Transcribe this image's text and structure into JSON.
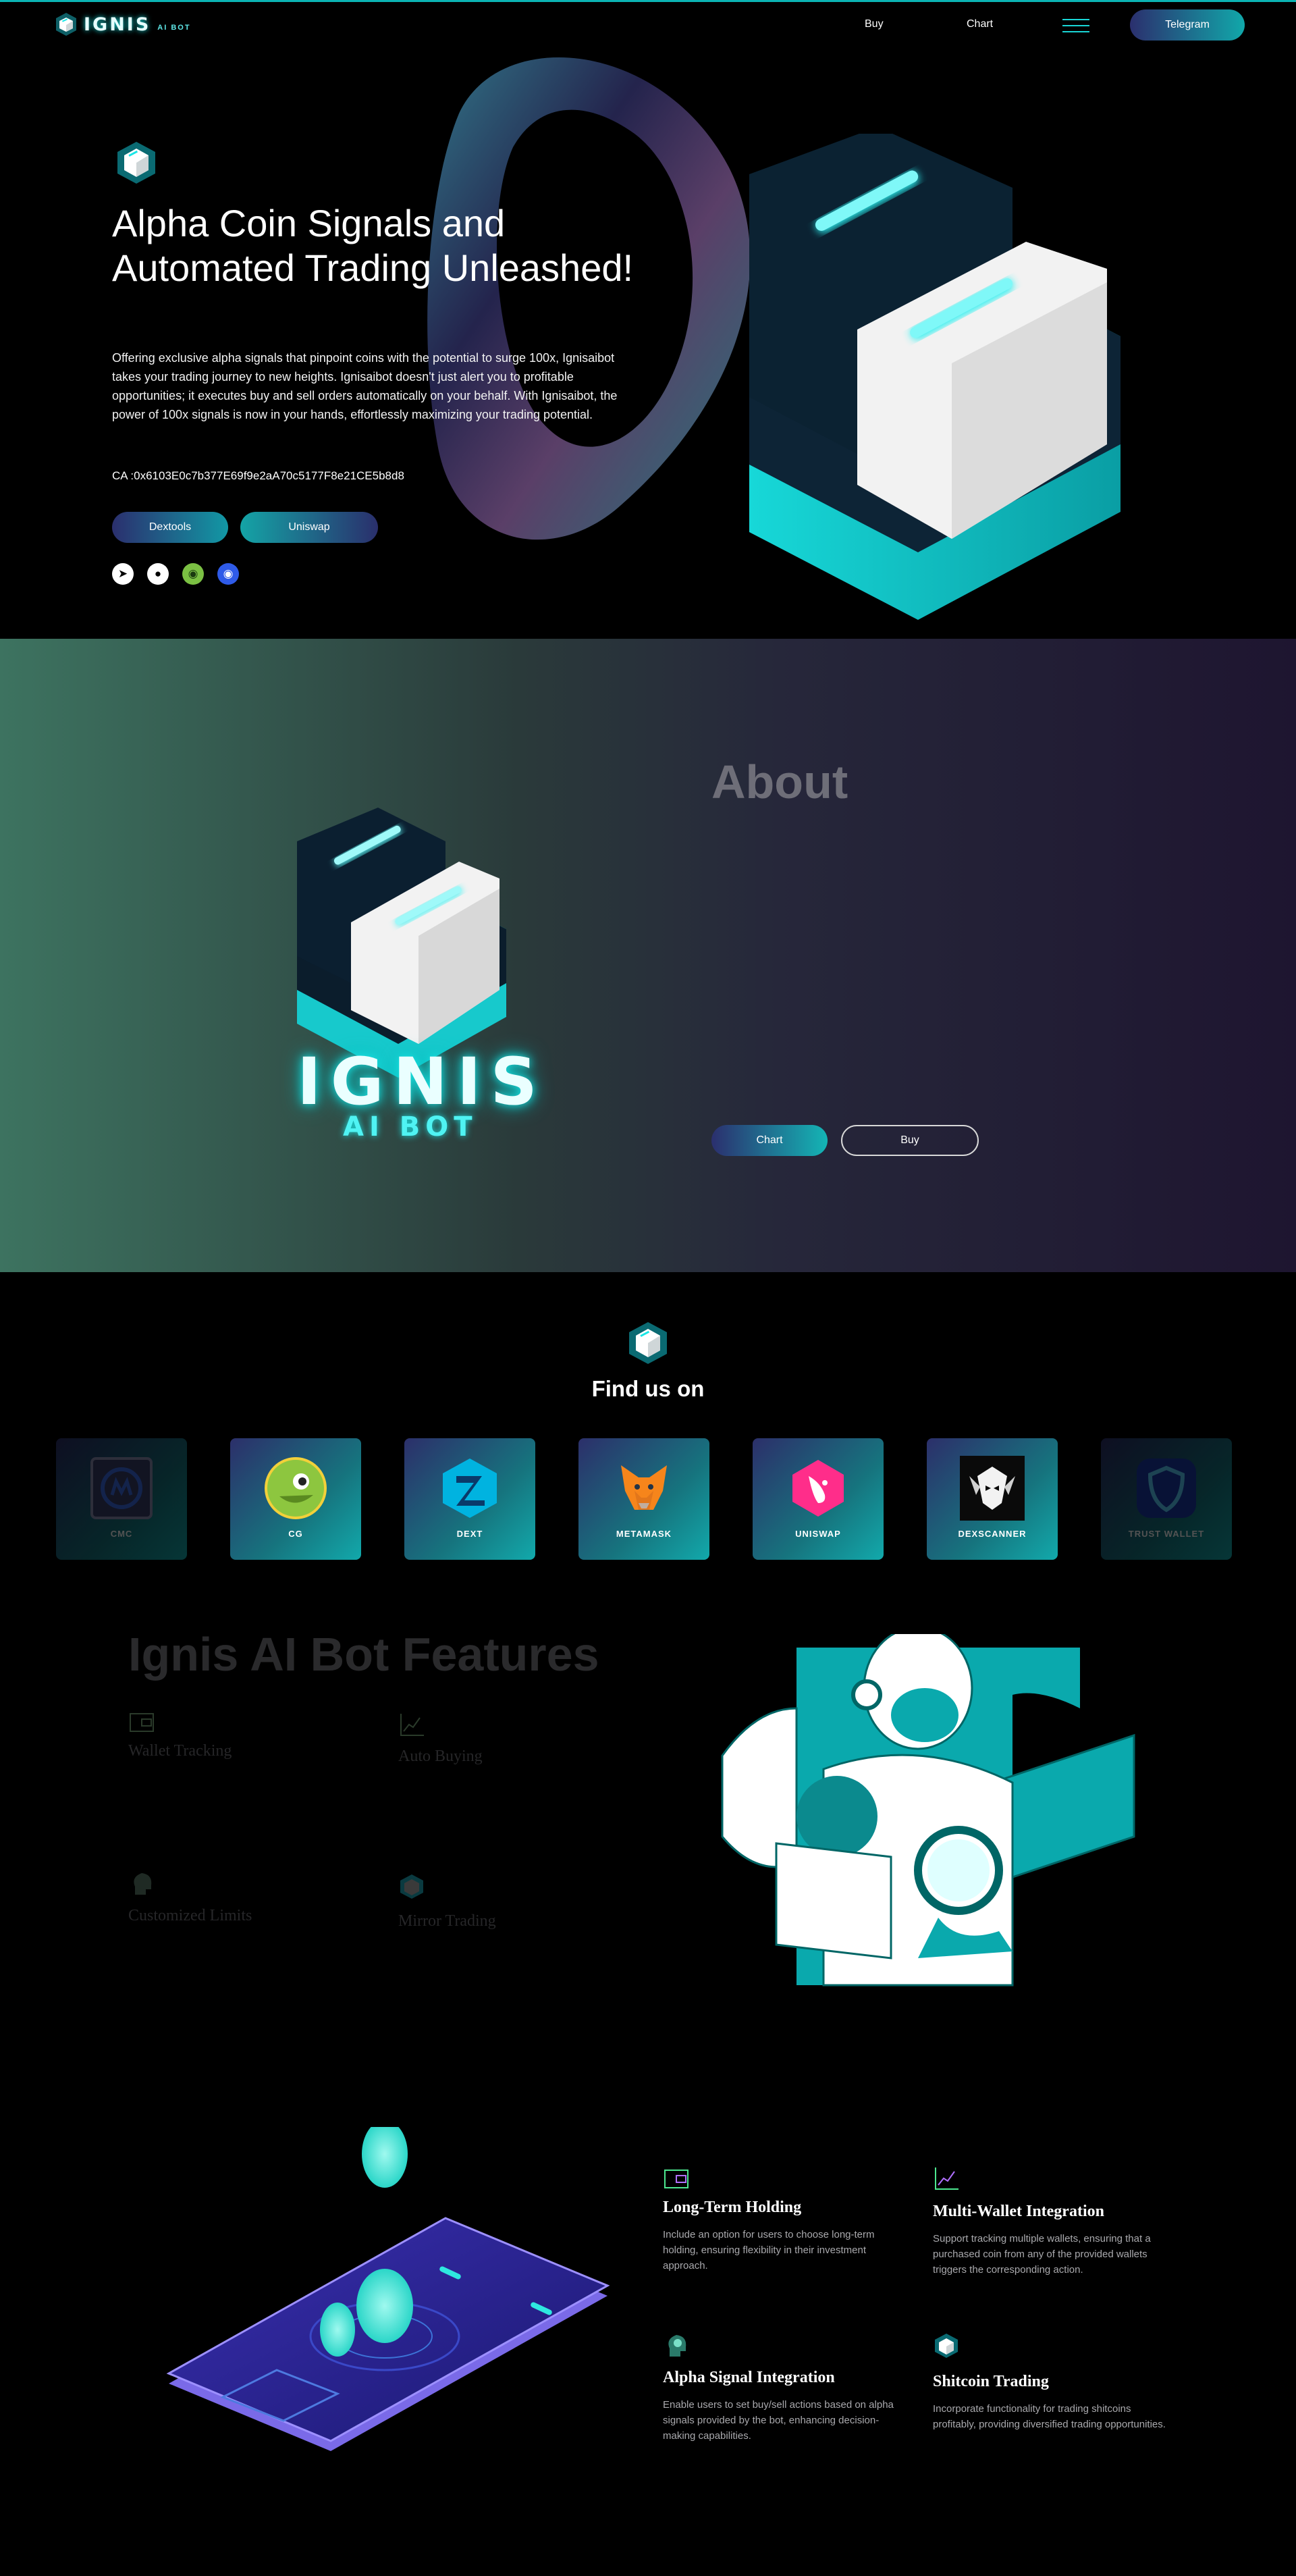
{
  "nav": {
    "brand": "IGNIS",
    "brand_sub": "AI BOT",
    "buy": "Buy",
    "chart": "Chart",
    "telegram": "Telegram"
  },
  "hero": {
    "title": "Alpha Coin Signals and Automated Trading Unleashed!",
    "description": "Offering exclusive alpha signals that pinpoint coins with the potential to surge 100x, Ignisaibot takes your trading journey to new heights. Ignisaibot doesn't just alert you to profitable opportunities; it executes buy and sell orders automatically on your behalf. With Ignisaibot, the power of 100x signals is now in your hands, effortlessly maximizing your trading potential.",
    "ca": "CA :0x6103E0c7b377E69f9e2aA70c5177F8e21CE5b8d8",
    "btn_dextools": "Dextools",
    "btn_uniswap": "Uniswap",
    "socials": [
      "telegram-icon",
      "twitter-icon",
      "dextools-icon",
      "coingecko-icon"
    ]
  },
  "about": {
    "logo_word": "IGNIS",
    "logo_sub": "AI BOT",
    "title": "About",
    "btn_chart": "Chart",
    "btn_buy": "Buy"
  },
  "find": {
    "title": "Find us on",
    "cards": [
      {
        "label": "CMC",
        "icon": "coinmarketcap-icon"
      },
      {
        "label": "CG",
        "icon": "coingecko-icon"
      },
      {
        "label": "DEXT",
        "icon": "dextools-icon"
      },
      {
        "label": "METAMASK",
        "icon": "metamask-icon"
      },
      {
        "label": "UNISWAP",
        "icon": "uniswap-icon"
      },
      {
        "label": "DEXSCANNER",
        "icon": "dexscreener-icon"
      },
      {
        "label": "TRUST WALLET",
        "icon": "trust-wallet-icon"
      }
    ]
  },
  "features": {
    "title": "Ignis AI Bot Features",
    "items": [
      "Wallet Tracking",
      "Auto Buying",
      "Customized Limits",
      "Mirror Trading"
    ]
  },
  "bottom_features": [
    {
      "title": "Long-Term Holding",
      "text": "Include an option for users to choose long-term holding, ensuring flexibility in their investment approach."
    },
    {
      "title": "Multi-Wallet Integration",
      "text": "Support tracking multiple wallets, ensuring that a purchased coin from any of the provided wallets triggers the corresponding action."
    },
    {
      "title": "Alpha Signal Integration",
      "text": "Enable users to set buy/sell actions based on alpha signals provided by the bot, enhancing decision-making capabilities."
    },
    {
      "title": "Shitcoin Trading",
      "text": "Incorporate functionality for trading shitcoins profitably, providing diversified trading opportunities."
    }
  ],
  "colors": {
    "accent": "#19d6d6",
    "navy": "#2b2f6e",
    "bg": "#000000"
  }
}
